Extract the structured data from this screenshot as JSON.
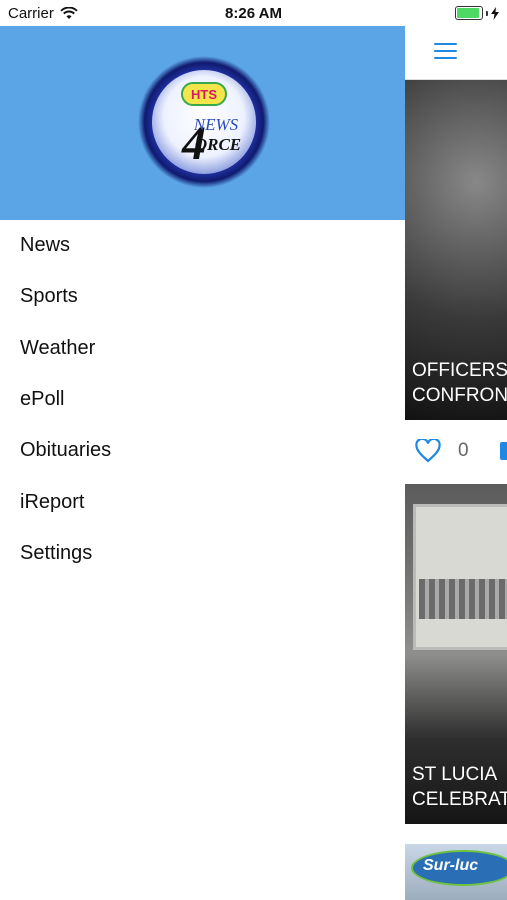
{
  "status_bar": {
    "carrier": "Carrier",
    "time": "8:26 AM"
  },
  "drawer": {
    "logo": {
      "badge": "HTS",
      "line1": "NEWS",
      "numeral": "4",
      "line2": "ORCE"
    },
    "menu": [
      "News",
      "Sports",
      "Weather",
      "ePoll",
      "Obituaries",
      "iReport",
      "Settings"
    ]
  },
  "feed": {
    "cards": [
      {
        "title_line1": "OFFICERS",
        "title_line2": "CONFRON",
        "likes": "0"
      },
      {
        "title_line1": "ST LUCIA",
        "title_line2": "CELEBRAT"
      }
    ],
    "third_card_logo_text": "Sur-luc"
  },
  "colors": {
    "header_blue": "#5ba5e6",
    "accent_blue": "#1e88e5",
    "battery_green": "#4cd964"
  }
}
